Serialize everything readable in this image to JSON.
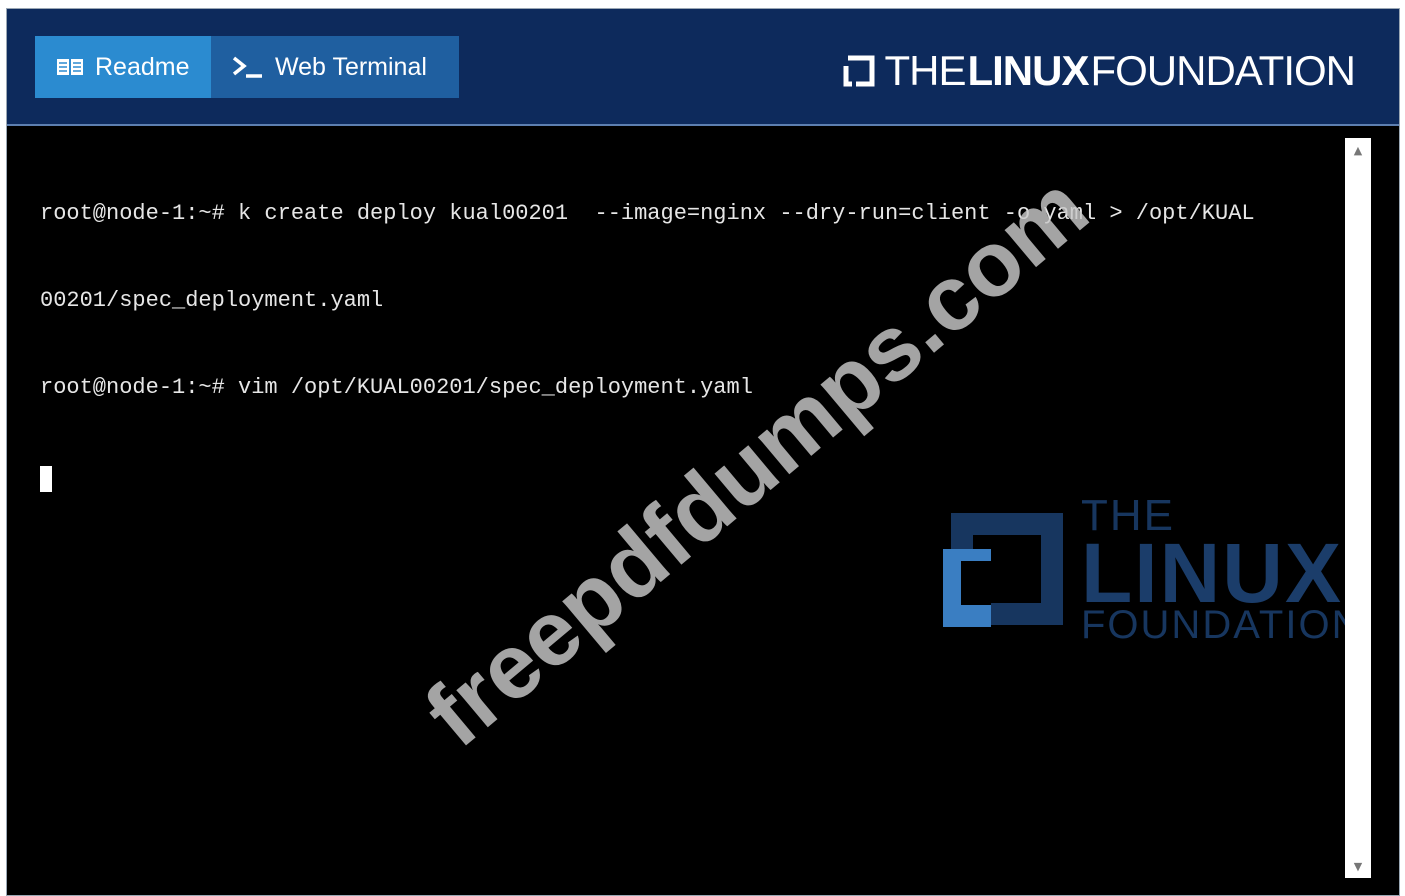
{
  "header": {
    "tabs": [
      {
        "label": "Readme",
        "icon": "book-icon",
        "active": true
      },
      {
        "label": "Web Terminal",
        "icon": "terminal-prompt-icon",
        "active": false
      }
    ],
    "brand": {
      "prefix": "THE",
      "main": "LINUX",
      "suffix": "FOUNDATION"
    }
  },
  "terminal": {
    "lines": [
      "root@node-1:~# k create deploy kual00201  --image=nginx --dry-run=client -o yaml > /opt/KUAL",
      "00201/spec_deployment.yaml",
      "root@node-1:~# vim /opt/KUAL00201/spec_deployment.yaml"
    ]
  },
  "background_logo": {
    "line1": "THE",
    "line2": "LINUX",
    "line3": "FOUNDATION"
  },
  "watermark": "freepdfdumps.com",
  "colors": {
    "header_bg": "#0d2a5c",
    "tab_active": "#2b8bd0",
    "tab_inactive": "#1f5fa0",
    "terminal_bg": "#000000",
    "terminal_text": "#e6e6e6"
  }
}
